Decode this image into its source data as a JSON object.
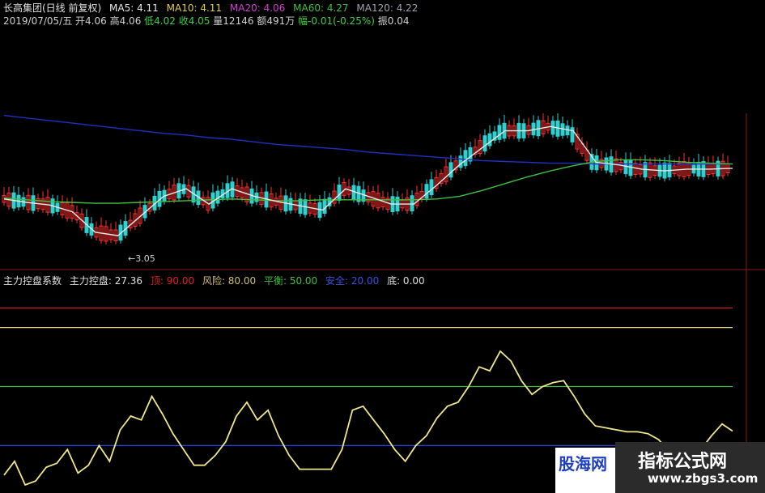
{
  "header": {
    "stock": "长高集团(日线 前复权)",
    "ma5": "MA5: 4.11",
    "ma10": "MA10: 4.11",
    "ma20": "MA20: 4.06",
    "ma60": "MA60: 4.27",
    "ma120": "MA120: 4.22",
    "date": "2019/07/05/五",
    "open": "开4.06",
    "high": "高4.06",
    "low": "低4.02",
    "close": "收4.05",
    "volume": "量12146",
    "amount": "额491万",
    "change": "幅-0.01(-0.25%)",
    "amplitude": "振0.04"
  },
  "indicator": {
    "name": "主力控盘系数",
    "value": "主力控盘: 27.36",
    "top": "顶: 90.00",
    "risk": "风险: 80.00",
    "balance": "平衡: 50.00",
    "safe": "安全: 20.00",
    "bottom": "底: 0.00"
  },
  "min_label": "←3.05",
  "watermark": {
    "left": "股海网",
    "right_cn": "指标公式网",
    "right_url": "www.zbgs3.com"
  },
  "colors": {
    "ma5": "#e8e8e8",
    "ma10": "#e0d040",
    "ma20": "#d040d0",
    "ma60": "#40c040",
    "ma120": "#9090a0",
    "long_ma": "#2030c0",
    "up": "#ff3030",
    "down": "#30d0d0",
    "zlkp": "#f0e68c",
    "lvl_top": "#e02020",
    "lvl_risk": "#e0d080",
    "lvl_balance": "#40c040",
    "lvl_safe": "#3040e0"
  },
  "chart_data": [
    {
      "type": "line",
      "title": "长高集团(日线 前复权)",
      "min_label": 3.05,
      "series": [
        {
          "name": "MA120",
          "values": [
            4.73,
            4.7,
            4.67,
            4.64,
            4.61,
            4.58,
            4.55,
            4.52,
            4.5,
            4.47,
            4.45,
            4.42,
            4.39,
            4.37,
            4.35,
            4.33,
            4.3,
            4.28,
            4.26,
            4.24,
            4.22,
            4.2,
            4.19,
            4.18,
            4.17,
            4.17,
            4.16,
            4.16,
            4.16,
            4.16,
            4.16,
            4.16,
            4.16
          ]
        },
        {
          "name": "MA60",
          "values": [
            3.76,
            3.74,
            3.72,
            3.71,
            3.7,
            3.7,
            3.71,
            3.72,
            3.73,
            3.74,
            3.75,
            3.74,
            3.73,
            3.73,
            3.74,
            3.74,
            3.74,
            3.74,
            3.74,
            3.75,
            3.78,
            3.85,
            3.93,
            4.01,
            4.08,
            4.14,
            4.19,
            4.21,
            4.21,
            4.2,
            4.18,
            4.17,
            4.16
          ]
        },
        {
          "name": "MA5",
          "values": [
            3.75,
            3.71,
            3.68,
            3.6,
            3.36,
            3.32,
            3.55,
            3.78,
            3.87,
            3.69,
            3.87,
            3.78,
            3.72,
            3.67,
            3.62,
            3.87,
            3.78,
            3.69,
            3.69,
            3.91,
            4.15,
            4.35,
            4.55,
            4.55,
            4.6,
            4.55,
            4.18,
            4.15,
            4.1,
            4.08,
            4.1,
            4.1,
            4.11
          ]
        }
      ]
    },
    {
      "type": "line",
      "title": "主力控盘系数",
      "ylim": [
        0,
        100
      ],
      "levels": [
        90,
        80,
        50,
        20,
        0
      ],
      "series": [
        {
          "name": "主力控盘",
          "values": [
            5,
            12,
            0,
            2,
            9,
            11,
            18,
            6,
            10,
            20,
            12,
            28,
            35,
            33,
            45,
            36,
            26,
            18,
            10,
            10,
            15,
            22,
            35,
            42,
            33,
            38,
            25,
            15,
            8,
            8,
            8,
            8,
            18,
            38,
            40,
            33,
            26,
            18,
            12,
            20,
            25,
            34,
            40,
            42,
            50,
            60,
            58,
            68,
            63,
            53,
            46,
            50,
            52,
            53,
            45,
            36,
            30,
            29,
            28,
            27,
            27,
            26,
            23,
            17,
            14,
            20,
            18,
            25,
            31,
            27.36
          ]
        }
      ]
    }
  ]
}
